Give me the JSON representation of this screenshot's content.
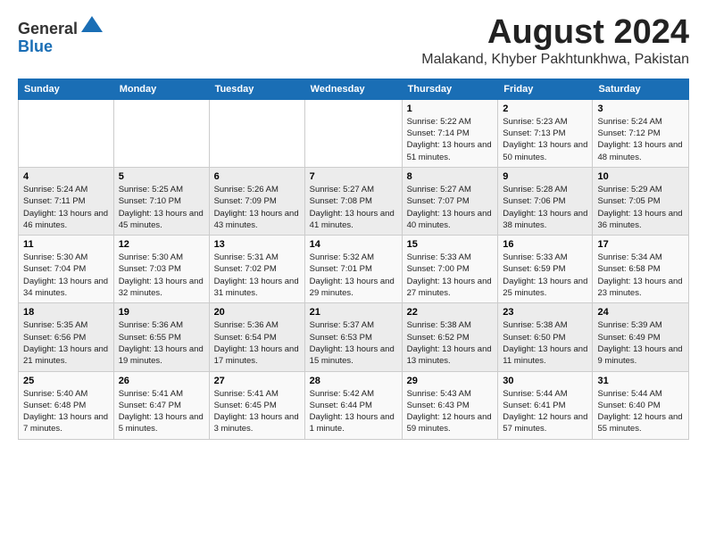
{
  "header": {
    "logo_line1": "General",
    "logo_line2": "Blue",
    "month_title": "August 2024",
    "location": "Malakand, Khyber Pakhtunkhwa, Pakistan"
  },
  "weekdays": [
    "Sunday",
    "Monday",
    "Tuesday",
    "Wednesday",
    "Thursday",
    "Friday",
    "Saturday"
  ],
  "weeks": [
    [
      {
        "day": "",
        "sunrise": "",
        "sunset": "",
        "daylight": ""
      },
      {
        "day": "",
        "sunrise": "",
        "sunset": "",
        "daylight": ""
      },
      {
        "day": "",
        "sunrise": "",
        "sunset": "",
        "daylight": ""
      },
      {
        "day": "",
        "sunrise": "",
        "sunset": "",
        "daylight": ""
      },
      {
        "day": "1",
        "sunrise": "Sunrise: 5:22 AM",
        "sunset": "Sunset: 7:14 PM",
        "daylight": "Daylight: 13 hours and 51 minutes."
      },
      {
        "day": "2",
        "sunrise": "Sunrise: 5:23 AM",
        "sunset": "Sunset: 7:13 PM",
        "daylight": "Daylight: 13 hours and 50 minutes."
      },
      {
        "day": "3",
        "sunrise": "Sunrise: 5:24 AM",
        "sunset": "Sunset: 7:12 PM",
        "daylight": "Daylight: 13 hours and 48 minutes."
      }
    ],
    [
      {
        "day": "4",
        "sunrise": "Sunrise: 5:24 AM",
        "sunset": "Sunset: 7:11 PM",
        "daylight": "Daylight: 13 hours and 46 minutes."
      },
      {
        "day": "5",
        "sunrise": "Sunrise: 5:25 AM",
        "sunset": "Sunset: 7:10 PM",
        "daylight": "Daylight: 13 hours and 45 minutes."
      },
      {
        "day": "6",
        "sunrise": "Sunrise: 5:26 AM",
        "sunset": "Sunset: 7:09 PM",
        "daylight": "Daylight: 13 hours and 43 minutes."
      },
      {
        "day": "7",
        "sunrise": "Sunrise: 5:27 AM",
        "sunset": "Sunset: 7:08 PM",
        "daylight": "Daylight: 13 hours and 41 minutes."
      },
      {
        "day": "8",
        "sunrise": "Sunrise: 5:27 AM",
        "sunset": "Sunset: 7:07 PM",
        "daylight": "Daylight: 13 hours and 40 minutes."
      },
      {
        "day": "9",
        "sunrise": "Sunrise: 5:28 AM",
        "sunset": "Sunset: 7:06 PM",
        "daylight": "Daylight: 13 hours and 38 minutes."
      },
      {
        "day": "10",
        "sunrise": "Sunrise: 5:29 AM",
        "sunset": "Sunset: 7:05 PM",
        "daylight": "Daylight: 13 hours and 36 minutes."
      }
    ],
    [
      {
        "day": "11",
        "sunrise": "Sunrise: 5:30 AM",
        "sunset": "Sunset: 7:04 PM",
        "daylight": "Daylight: 13 hours and 34 minutes."
      },
      {
        "day": "12",
        "sunrise": "Sunrise: 5:30 AM",
        "sunset": "Sunset: 7:03 PM",
        "daylight": "Daylight: 13 hours and 32 minutes."
      },
      {
        "day": "13",
        "sunrise": "Sunrise: 5:31 AM",
        "sunset": "Sunset: 7:02 PM",
        "daylight": "Daylight: 13 hours and 31 minutes."
      },
      {
        "day": "14",
        "sunrise": "Sunrise: 5:32 AM",
        "sunset": "Sunset: 7:01 PM",
        "daylight": "Daylight: 13 hours and 29 minutes."
      },
      {
        "day": "15",
        "sunrise": "Sunrise: 5:33 AM",
        "sunset": "Sunset: 7:00 PM",
        "daylight": "Daylight: 13 hours and 27 minutes."
      },
      {
        "day": "16",
        "sunrise": "Sunrise: 5:33 AM",
        "sunset": "Sunset: 6:59 PM",
        "daylight": "Daylight: 13 hours and 25 minutes."
      },
      {
        "day": "17",
        "sunrise": "Sunrise: 5:34 AM",
        "sunset": "Sunset: 6:58 PM",
        "daylight": "Daylight: 13 hours and 23 minutes."
      }
    ],
    [
      {
        "day": "18",
        "sunrise": "Sunrise: 5:35 AM",
        "sunset": "Sunset: 6:56 PM",
        "daylight": "Daylight: 13 hours and 21 minutes."
      },
      {
        "day": "19",
        "sunrise": "Sunrise: 5:36 AM",
        "sunset": "Sunset: 6:55 PM",
        "daylight": "Daylight: 13 hours and 19 minutes."
      },
      {
        "day": "20",
        "sunrise": "Sunrise: 5:36 AM",
        "sunset": "Sunset: 6:54 PM",
        "daylight": "Daylight: 13 hours and 17 minutes."
      },
      {
        "day": "21",
        "sunrise": "Sunrise: 5:37 AM",
        "sunset": "Sunset: 6:53 PM",
        "daylight": "Daylight: 13 hours and 15 minutes."
      },
      {
        "day": "22",
        "sunrise": "Sunrise: 5:38 AM",
        "sunset": "Sunset: 6:52 PM",
        "daylight": "Daylight: 13 hours and 13 minutes."
      },
      {
        "day": "23",
        "sunrise": "Sunrise: 5:38 AM",
        "sunset": "Sunset: 6:50 PM",
        "daylight": "Daylight: 13 hours and 11 minutes."
      },
      {
        "day": "24",
        "sunrise": "Sunrise: 5:39 AM",
        "sunset": "Sunset: 6:49 PM",
        "daylight": "Daylight: 13 hours and 9 minutes."
      }
    ],
    [
      {
        "day": "25",
        "sunrise": "Sunrise: 5:40 AM",
        "sunset": "Sunset: 6:48 PM",
        "daylight": "Daylight: 13 hours and 7 minutes."
      },
      {
        "day": "26",
        "sunrise": "Sunrise: 5:41 AM",
        "sunset": "Sunset: 6:47 PM",
        "daylight": "Daylight: 13 hours and 5 minutes."
      },
      {
        "day": "27",
        "sunrise": "Sunrise: 5:41 AM",
        "sunset": "Sunset: 6:45 PM",
        "daylight": "Daylight: 13 hours and 3 minutes."
      },
      {
        "day": "28",
        "sunrise": "Sunrise: 5:42 AM",
        "sunset": "Sunset: 6:44 PM",
        "daylight": "Daylight: 13 hours and 1 minute."
      },
      {
        "day": "29",
        "sunrise": "Sunrise: 5:43 AM",
        "sunset": "Sunset: 6:43 PM",
        "daylight": "Daylight: 12 hours and 59 minutes."
      },
      {
        "day": "30",
        "sunrise": "Sunrise: 5:44 AM",
        "sunset": "Sunset: 6:41 PM",
        "daylight": "Daylight: 12 hours and 57 minutes."
      },
      {
        "day": "31",
        "sunrise": "Sunrise: 5:44 AM",
        "sunset": "Sunset: 6:40 PM",
        "daylight": "Daylight: 12 hours and 55 minutes."
      }
    ]
  ]
}
